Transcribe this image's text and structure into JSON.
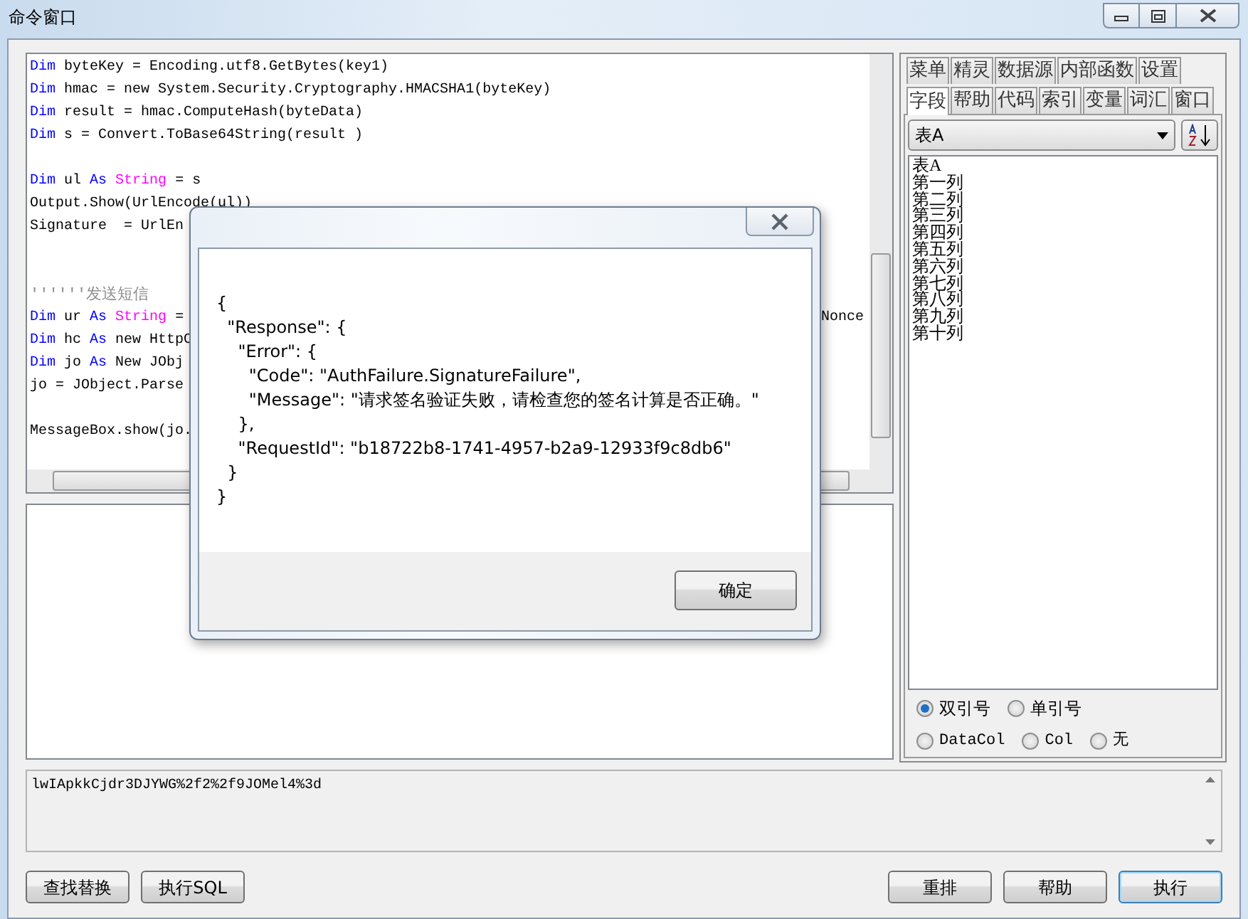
{
  "window": {
    "title": "命令窗口"
  },
  "editor": {
    "lines": [
      {
        "kind": "code",
        "tokens": [
          {
            "kind": "keyword",
            "text": "Dim"
          },
          {
            "kind": "plain",
            "text": " byteKey = Encoding.utf8.GetBytes(key1)"
          }
        ]
      },
      {
        "kind": "code",
        "tokens": [
          {
            "kind": "keyword",
            "text": "Dim"
          },
          {
            "kind": "plain",
            "text": " hmac = new System.Security.Cryptography.HMACSHA1(byteKey)"
          }
        ]
      },
      {
        "kind": "code",
        "tokens": [
          {
            "kind": "keyword",
            "text": "Dim"
          },
          {
            "kind": "plain",
            "text": " result = hmac.ComputeHash(byteData)"
          }
        ]
      },
      {
        "kind": "code",
        "tokens": [
          {
            "kind": "keyword",
            "text": "Dim"
          },
          {
            "kind": "plain",
            "text": " s = Convert.ToBase64String(result )"
          }
        ]
      },
      {
        "kind": "blank"
      },
      {
        "kind": "code",
        "tokens": [
          {
            "kind": "keyword",
            "text": "Dim"
          },
          {
            "kind": "plain",
            "text": " ul "
          },
          {
            "kind": "keyword",
            "text": "As"
          },
          {
            "kind": "type",
            "text": " String"
          },
          {
            "kind": "plain",
            "text": " = s"
          }
        ]
      },
      {
        "kind": "code",
        "tokens": [
          {
            "kind": "plain",
            "text": "Output.Show(UrlEncode(ul))"
          }
        ]
      },
      {
        "kind": "code",
        "tokens": [
          {
            "kind": "plain",
            "text": "Signature  = UrlEn"
          }
        ]
      },
      {
        "kind": "blank"
      },
      {
        "kind": "blank"
      },
      {
        "kind": "code",
        "tokens": [
          {
            "kind": "comment",
            "text": "''''''发送短信"
          }
        ]
      },
      {
        "kind": "code",
        "tokens": [
          {
            "kind": "keyword",
            "text": "Dim"
          },
          {
            "kind": "plain",
            "text": " ur "
          },
          {
            "kind": "keyword",
            "text": "As"
          },
          {
            "kind": "type",
            "text": " String"
          },
          {
            "kind": "plain",
            "text": " ="
          }
        ],
        "tail": "Nonce"
      },
      {
        "kind": "code",
        "tokens": [
          {
            "kind": "keyword",
            "text": "Dim"
          },
          {
            "kind": "plain",
            "text": " hc "
          },
          {
            "kind": "keyword",
            "text": "As"
          },
          {
            "kind": "plain",
            "text": " new HttpC"
          }
        ]
      },
      {
        "kind": "code",
        "tokens": [
          {
            "kind": "keyword",
            "text": "Dim"
          },
          {
            "kind": "plain",
            "text": " jo "
          },
          {
            "kind": "keyword",
            "text": "As"
          },
          {
            "kind": "plain",
            "text": " New JObj"
          }
        ]
      },
      {
        "kind": "code",
        "tokens": [
          {
            "kind": "plain",
            "text": "jo = JObject.Parse"
          }
        ]
      },
      {
        "kind": "blank"
      },
      {
        "kind": "code",
        "tokens": [
          {
            "kind": "plain",
            "text": "MessageBox.show(jo."
          }
        ]
      }
    ]
  },
  "side_panel": {
    "tab_rows": [
      [
        {
          "label": "菜单",
          "selected": false
        },
        {
          "label": "精灵",
          "selected": false
        },
        {
          "label": "数据源",
          "selected": false
        },
        {
          "label": "内部函数",
          "selected": false
        },
        {
          "label": "设置",
          "selected": false
        }
      ],
      [
        {
          "label": "字段",
          "selected": true
        },
        {
          "label": "帮助",
          "selected": false
        },
        {
          "label": "代码",
          "selected": false
        },
        {
          "label": "索引",
          "selected": false
        },
        {
          "label": "变量",
          "selected": false
        },
        {
          "label": "词汇",
          "selected": false
        },
        {
          "label": "窗口",
          "selected": false
        }
      ]
    ],
    "table_select": {
      "value": "表A"
    },
    "fields": [
      "表A",
      "第一列",
      "第二列",
      "第三列",
      "第四列",
      "第五列",
      "第六列",
      "第七列",
      "第八列",
      "第九列",
      "第十列"
    ],
    "quote_options": [
      {
        "label": "双引号",
        "selected": true
      },
      {
        "label": "单引号",
        "selected": false
      }
    ],
    "column_options": [
      {
        "label": "DataCol",
        "selected": false
      },
      {
        "label": "Col",
        "selected": false
      },
      {
        "label": "无",
        "selected": false
      }
    ]
  },
  "result_text": "lwIApkkCjdr3DJYWG%2f2%2f9JOMel4%3d",
  "buttons_left": [
    {
      "label": "查找替换",
      "default": false
    },
    {
      "label": "执行SQL",
      "default": false
    }
  ],
  "buttons_right": [
    {
      "label": "重排",
      "default": false
    },
    {
      "label": "帮助",
      "default": false
    },
    {
      "label": "执行",
      "default": true
    }
  ],
  "dialog": {
    "message_lines": [
      "{",
      "  \"Response\": {",
      "    \"Error\": {",
      "      \"Code\": \"AuthFailure.SignatureFailure\",",
      "      \"Message\": \"请求签名验证失败，请检查您的签名计算是否正确。\"",
      "    },",
      "    \"RequestId\": \"b18722b8-1741-4957-b2a9-12933f9c8db6\"",
      "  }",
      "}"
    ],
    "ok_button": "确定"
  }
}
